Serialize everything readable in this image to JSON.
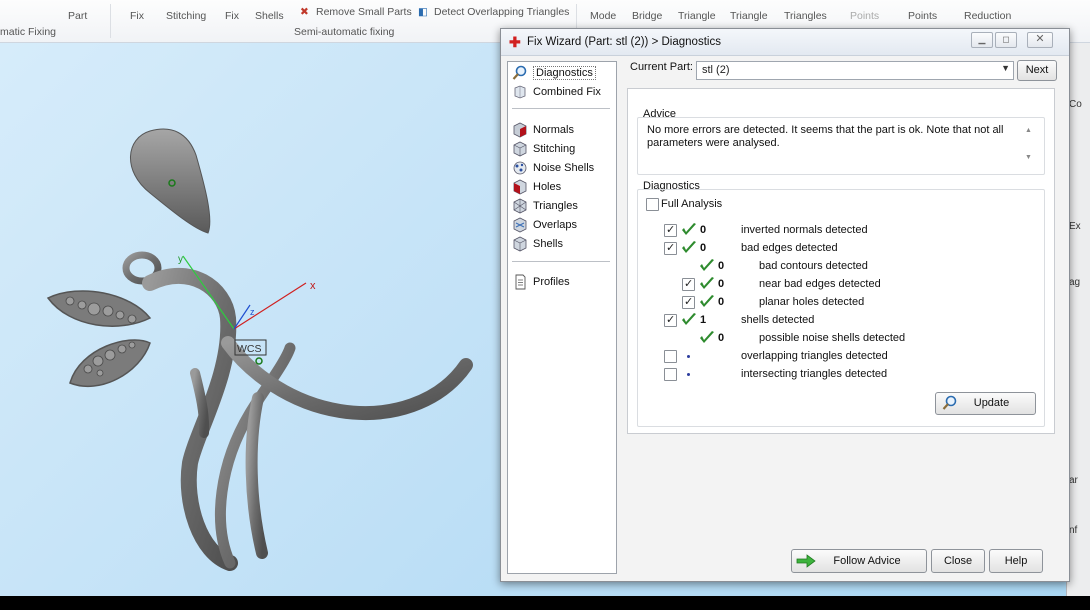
{
  "ribbon": {
    "top_labels": [
      "Part",
      "Fix",
      "Stitching",
      "Fix",
      "Shells",
      "Remove Small Parts",
      "Detect Overlapping Triangles",
      "Mode",
      "Bridge",
      "Triangle",
      "Triangle",
      "Triangles",
      "Points",
      "Points",
      "Reduction"
    ],
    "groups": [
      "Semi-automatic fixing",
      "matic Fixing"
    ]
  },
  "viewport": {
    "wcs_label": "WCS",
    "axis_x": "x",
    "axis_y": "y",
    "axis_z": "z"
  },
  "right_strip": [
    "Co",
    "Ex",
    "ag",
    "ar",
    "nf"
  ],
  "dialog": {
    "title": "Fix Wizard (Part: stl  (2)) > Diagnostics",
    "nav": {
      "items": [
        {
          "label": "Diagnostics",
          "icon": "magnifier-icon",
          "selected": true
        },
        {
          "label": "Combined Fix",
          "icon": "combined-fix-icon"
        },
        {
          "label": "Normals",
          "icon": "normals-cube-icon"
        },
        {
          "label": "Stitching",
          "icon": "stitching-cube-icon"
        },
        {
          "label": "Noise Shells",
          "icon": "noise-shells-icon"
        },
        {
          "label": "Holes",
          "icon": "holes-cube-icon"
        },
        {
          "label": "Triangles",
          "icon": "triangles-cube-icon"
        },
        {
          "label": "Overlaps",
          "icon": "overlaps-cube-icon"
        },
        {
          "label": "Shells",
          "icon": "shells-cube-icon"
        },
        {
          "label": "Profiles",
          "icon": "document-icon"
        }
      ]
    },
    "current_part_label": "Current Part:",
    "current_part_value": "stl  (2)",
    "next_button": "Next",
    "advice_title": "Advice",
    "advice_text": "No more errors are detected. It seems that the part is ok. Note that not all parameters were analysed.",
    "diagnostics_title": "Diagnostics",
    "full_analysis_label": "Full Analysis",
    "full_analysis_checked": false,
    "rows": [
      {
        "checkbox": true,
        "checked": true,
        "status": "ok",
        "count": "0",
        "label": "inverted normals detected",
        "indent": 0
      },
      {
        "checkbox": true,
        "checked": true,
        "status": "ok",
        "count": "0",
        "label": "bad edges detected",
        "indent": 0
      },
      {
        "checkbox": false,
        "checked": false,
        "status": "ok",
        "count": "0",
        "label": "bad contours detected",
        "indent": 1
      },
      {
        "checkbox": true,
        "checked": true,
        "status": "ok",
        "count": "0",
        "label": "near bad edges detected",
        "indent": 1
      },
      {
        "checkbox": true,
        "checked": true,
        "status": "ok",
        "count": "0",
        "label": "planar holes detected",
        "indent": 1
      },
      {
        "checkbox": true,
        "checked": true,
        "status": "ok",
        "count": "1",
        "label": "shells detected",
        "indent": 0
      },
      {
        "checkbox": false,
        "checked": false,
        "status": "ok",
        "count": "0",
        "label": "possible noise shells detected",
        "indent": 1
      },
      {
        "checkbox": true,
        "checked": false,
        "status": "pending",
        "count": "",
        "label": "overlapping triangles detected",
        "indent": 0
      },
      {
        "checkbox": true,
        "checked": false,
        "status": "pending",
        "count": "",
        "label": "intersecting triangles detected",
        "indent": 0
      }
    ],
    "update_button": "Update",
    "follow_advice_button": "Follow Advice",
    "close_button": "Close",
    "help_button": "Help"
  },
  "colors": {
    "check_green": "#2e8b2e",
    "viewport_bg": "#c3e2f7",
    "model_gray": "#6f6f6f"
  }
}
